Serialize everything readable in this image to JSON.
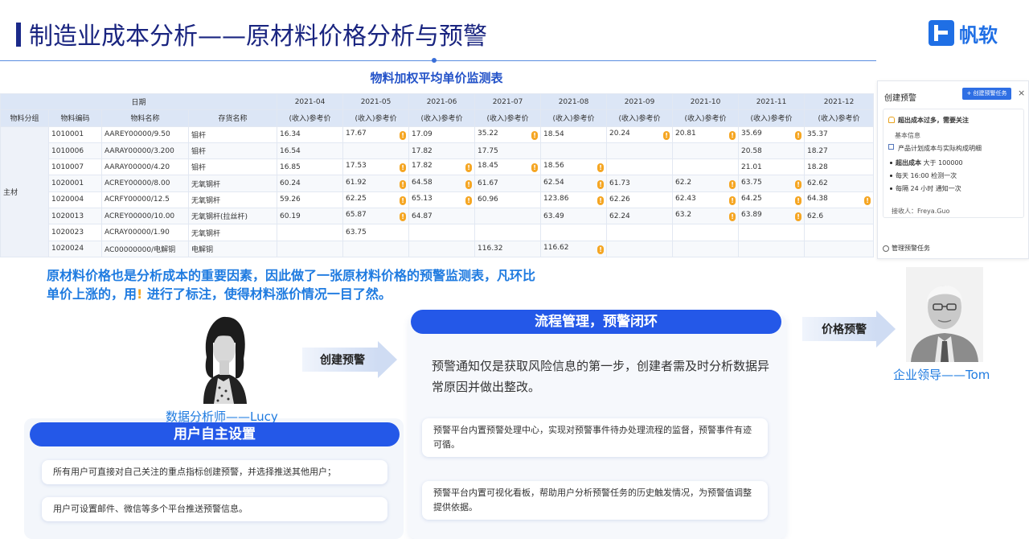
{
  "header": {
    "title": "制造业成本分析——原材料价格分析与预警",
    "logo_text": "帆软",
    "brand_color": "#1f6fe5"
  },
  "table": {
    "title": "物料加权平均单价监测表",
    "group_label": "日期",
    "months": [
      "2021-04",
      "2021-05",
      "2021-06",
      "2021-07",
      "2021-08",
      "2021-09",
      "2021-10",
      "2021-11",
      "2021-12"
    ],
    "columns": [
      "物料分组",
      "物料编码",
      "物料名称",
      "存货名称"
    ],
    "measure_label": "(收入)参考价",
    "group_value": "主材",
    "rows": [
      {
        "code": "1010001",
        "name": "AAREY00000/9.50",
        "inv": "钼杆",
        "vals": [
          "16.34",
          "17.67",
          "17.09",
          "35.22",
          "18.54",
          "20.24",
          "20.81",
          "35.69",
          "35.37"
        ]
      },
      {
        "code": "1010006",
        "name": "AARAY00000/3.200",
        "inv": "钼杆",
        "vals": [
          "16.54",
          "",
          "17.82",
          "17.75",
          "",
          "",
          "",
          "20.58",
          "18.27"
        ]
      },
      {
        "code": "1010007",
        "name": "AARAY00000/4.20",
        "inv": "钼杆",
        "vals": [
          "16.85",
          "17.53",
          "17.82",
          "18.45",
          "18.56",
          "",
          "",
          "21.01",
          "18.28"
        ]
      },
      {
        "code": "1020001",
        "name": "ACREY00000/8.00",
        "inv": "无氧钢杆",
        "vals": [
          "60.24",
          "61.92",
          "64.58",
          "61.67",
          "62.54",
          "61.73",
          "62.2",
          "63.75",
          "62.62"
        ]
      },
      {
        "code": "1020004",
        "name": "ACRFY00000/12.5",
        "inv": "无氧钢杆",
        "vals": [
          "59.26",
          "62.25",
          "65.13",
          "60.96",
          "123.86",
          "62.26",
          "62.43",
          "64.25",
          "64.38"
        ]
      },
      {
        "code": "1020013",
        "name": "ACREY00000/10.00",
        "inv": "无氧钢杆(拉丝杆)",
        "vals": [
          "60.19",
          "65.87",
          "64.87",
          "",
          "63.49",
          "62.24",
          "63.2",
          "63.89",
          "62.6"
        ]
      },
      {
        "code": "1020023",
        "name": "ACRAY00000/1.90",
        "inv": "无氧钢杆",
        "vals": [
          "",
          "63.75",
          "",
          "",
          "",
          "",
          "",
          "",
          ""
        ]
      },
      {
        "code": "1020024",
        "name": "AC00000000/电解铜",
        "inv": "电解铜",
        "vals": [
          "",
          "",
          "",
          "116.32",
          "116.62",
          "",
          "",
          "",
          ""
        ]
      }
    ],
    "warning_color": "#f5a623"
  },
  "panel": {
    "title": "创建预警",
    "create_button": "+ 创建预警任务",
    "close": "×",
    "card_title": "超出成本过多，需要关注",
    "section": "基本信息",
    "detail": "产品计划成本与实际构成明细",
    "rule_label": "超出成本",
    "rule_value": "大于 100000",
    "schedule1": "每天 16:00 检测一次",
    "schedule2": "每隔 24 小时 通知一次",
    "receiver": "接收人：Freya.Guo",
    "footer": "管理预警任务"
  },
  "description": {
    "line1": "原材料价格也是分析成本的重要因素，因此做了一张原材料价格的预警监测表，凡环比",
    "line2a": "单价上涨的，用",
    "mark": "!",
    "line2b": " 进行了标注，使得材料涨价情况一目了然。"
  },
  "people": {
    "analyst_caption": "数据分析师——Lucy",
    "leader_caption": "企业领导——Tom"
  },
  "arrows": {
    "create": "创建预警",
    "price": "价格预警"
  },
  "left_card": {
    "pill": "用户自主设置",
    "note1": "所有用户可直接对自己关注的重点指标创建预警，并选择推送其他用户；",
    "note2": "用户可设置邮件、微信等多个平台推送预警信息。"
  },
  "mid_card": {
    "pill": "流程管理，预警闭环",
    "text": "预警通知仅是获取风险信息的第一步，创建者需及时分析数据异常原因并做出整改。",
    "note1": "预警平台内置预警处理中心，实现对预警事件待办处理流程的监督，预警事件有迹可循。",
    "note2": "预警平台内置可视化看板，帮助用户分析预警任务的历史触发情况，为预警值调整提供依据。"
  },
  "accent_color": "#2458e8"
}
